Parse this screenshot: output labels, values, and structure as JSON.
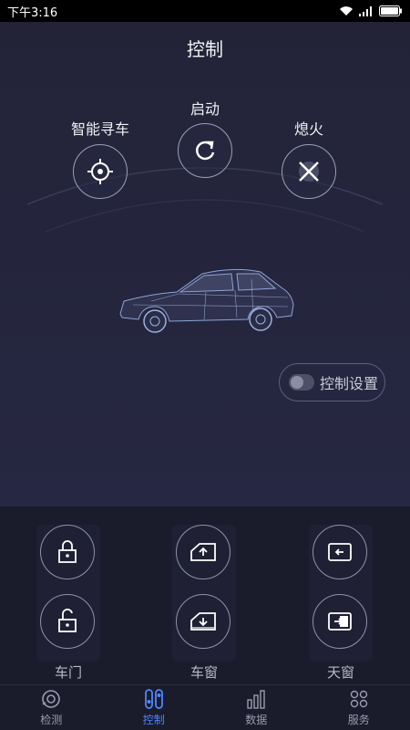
{
  "status": {
    "time": "下午3:16"
  },
  "header": {
    "title": "控制"
  },
  "controls": {
    "find_car": {
      "label": "智能寻车",
      "icon": "crosshair-icon"
    },
    "start": {
      "label": "启动",
      "icon": "refresh-icon"
    },
    "stop": {
      "label": "熄火",
      "icon": "close-x-icon"
    }
  },
  "settings": {
    "label": "控制设置"
  },
  "groups": [
    {
      "label": "车门"
    },
    {
      "label": "车窗"
    },
    {
      "label": "天窗"
    }
  ],
  "tabs": [
    {
      "label": "检测",
      "icon": "detect-icon"
    },
    {
      "label": "控制",
      "icon": "control-icon"
    },
    {
      "label": "数据",
      "icon": "bar-chart-icon"
    },
    {
      "label": "服务",
      "icon": "dots-grid-icon"
    }
  ],
  "colors": {
    "accent": "#4f86ff",
    "background": "#22223a",
    "panel": "#1a1b2b"
  }
}
